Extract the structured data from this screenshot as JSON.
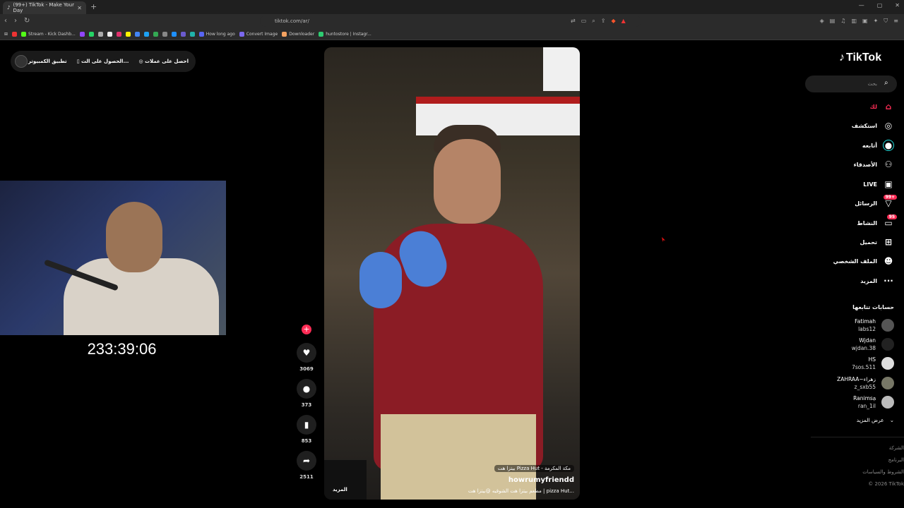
{
  "browser": {
    "tab_title": "(99+) TikTok - Make Your Day",
    "url": "tiktok.com/ar/",
    "bookmarks": [
      "Stream - Kick Dashb...",
      "How long ago",
      "Convert Image",
      "Downloader",
      "huntostore | Instagr..."
    ]
  },
  "pill": {
    "coins": "احصل على عملات",
    "get_app": "الحصول على الت...",
    "desktop_app": "تطبيق الكمبيوتر"
  },
  "stream": {
    "timer": "233:39:06"
  },
  "video": {
    "tag": "بيتزا هت Pizza Hut - مكة المكرمة",
    "username": "howrumyfriendd",
    "description": "مطعم بيتزا هت الشوقيه @بيتزا هت | pizza Hut...",
    "more": "المزيد"
  },
  "actions": {
    "likes": "3069",
    "comments": "373",
    "saves": "853",
    "shares": "2511"
  },
  "sidebar": {
    "logo": "TikTok",
    "search_placeholder": "بحث",
    "nav": [
      {
        "label": "لك",
        "icon": "home-icon"
      },
      {
        "label": "استكشف",
        "icon": "compass-icon"
      },
      {
        "label": "أتابعه",
        "icon": "following-avatar-icon"
      },
      {
        "label": "الأصدقاء",
        "icon": "friends-icon"
      },
      {
        "label": "LIVE",
        "icon": "live-icon"
      },
      {
        "label": "الرسائل",
        "icon": "messages-icon",
        "badge": "99+"
      },
      {
        "label": "النشاط",
        "icon": "activity-icon",
        "badge": "95"
      },
      {
        "label": "تحميل",
        "icon": "upload-icon"
      },
      {
        "label": "الملف الشخصي",
        "icon": "profile-icon"
      },
      {
        "label": "المزيد",
        "icon": "more-icon"
      }
    ],
    "following_title": "حسابات تتابعها",
    "accounts": [
      {
        "name": "Fatimah",
        "user": "labs12"
      },
      {
        "name": "Wjdan",
        "user": "wjdan.38"
      },
      {
        "name": "HS",
        "user": "7sos.511"
      },
      {
        "name": "ZAHRAA~زهراء",
        "user": "z_sxb55"
      },
      {
        "name": "Ranimsa᷂",
        "user": "ran_1il"
      }
    ],
    "see_more": "عرض المزيد",
    "footer": [
      "الشركة",
      "البرنامج",
      "الشروط والسياسات",
      "© 2026 TikTok"
    ]
  }
}
